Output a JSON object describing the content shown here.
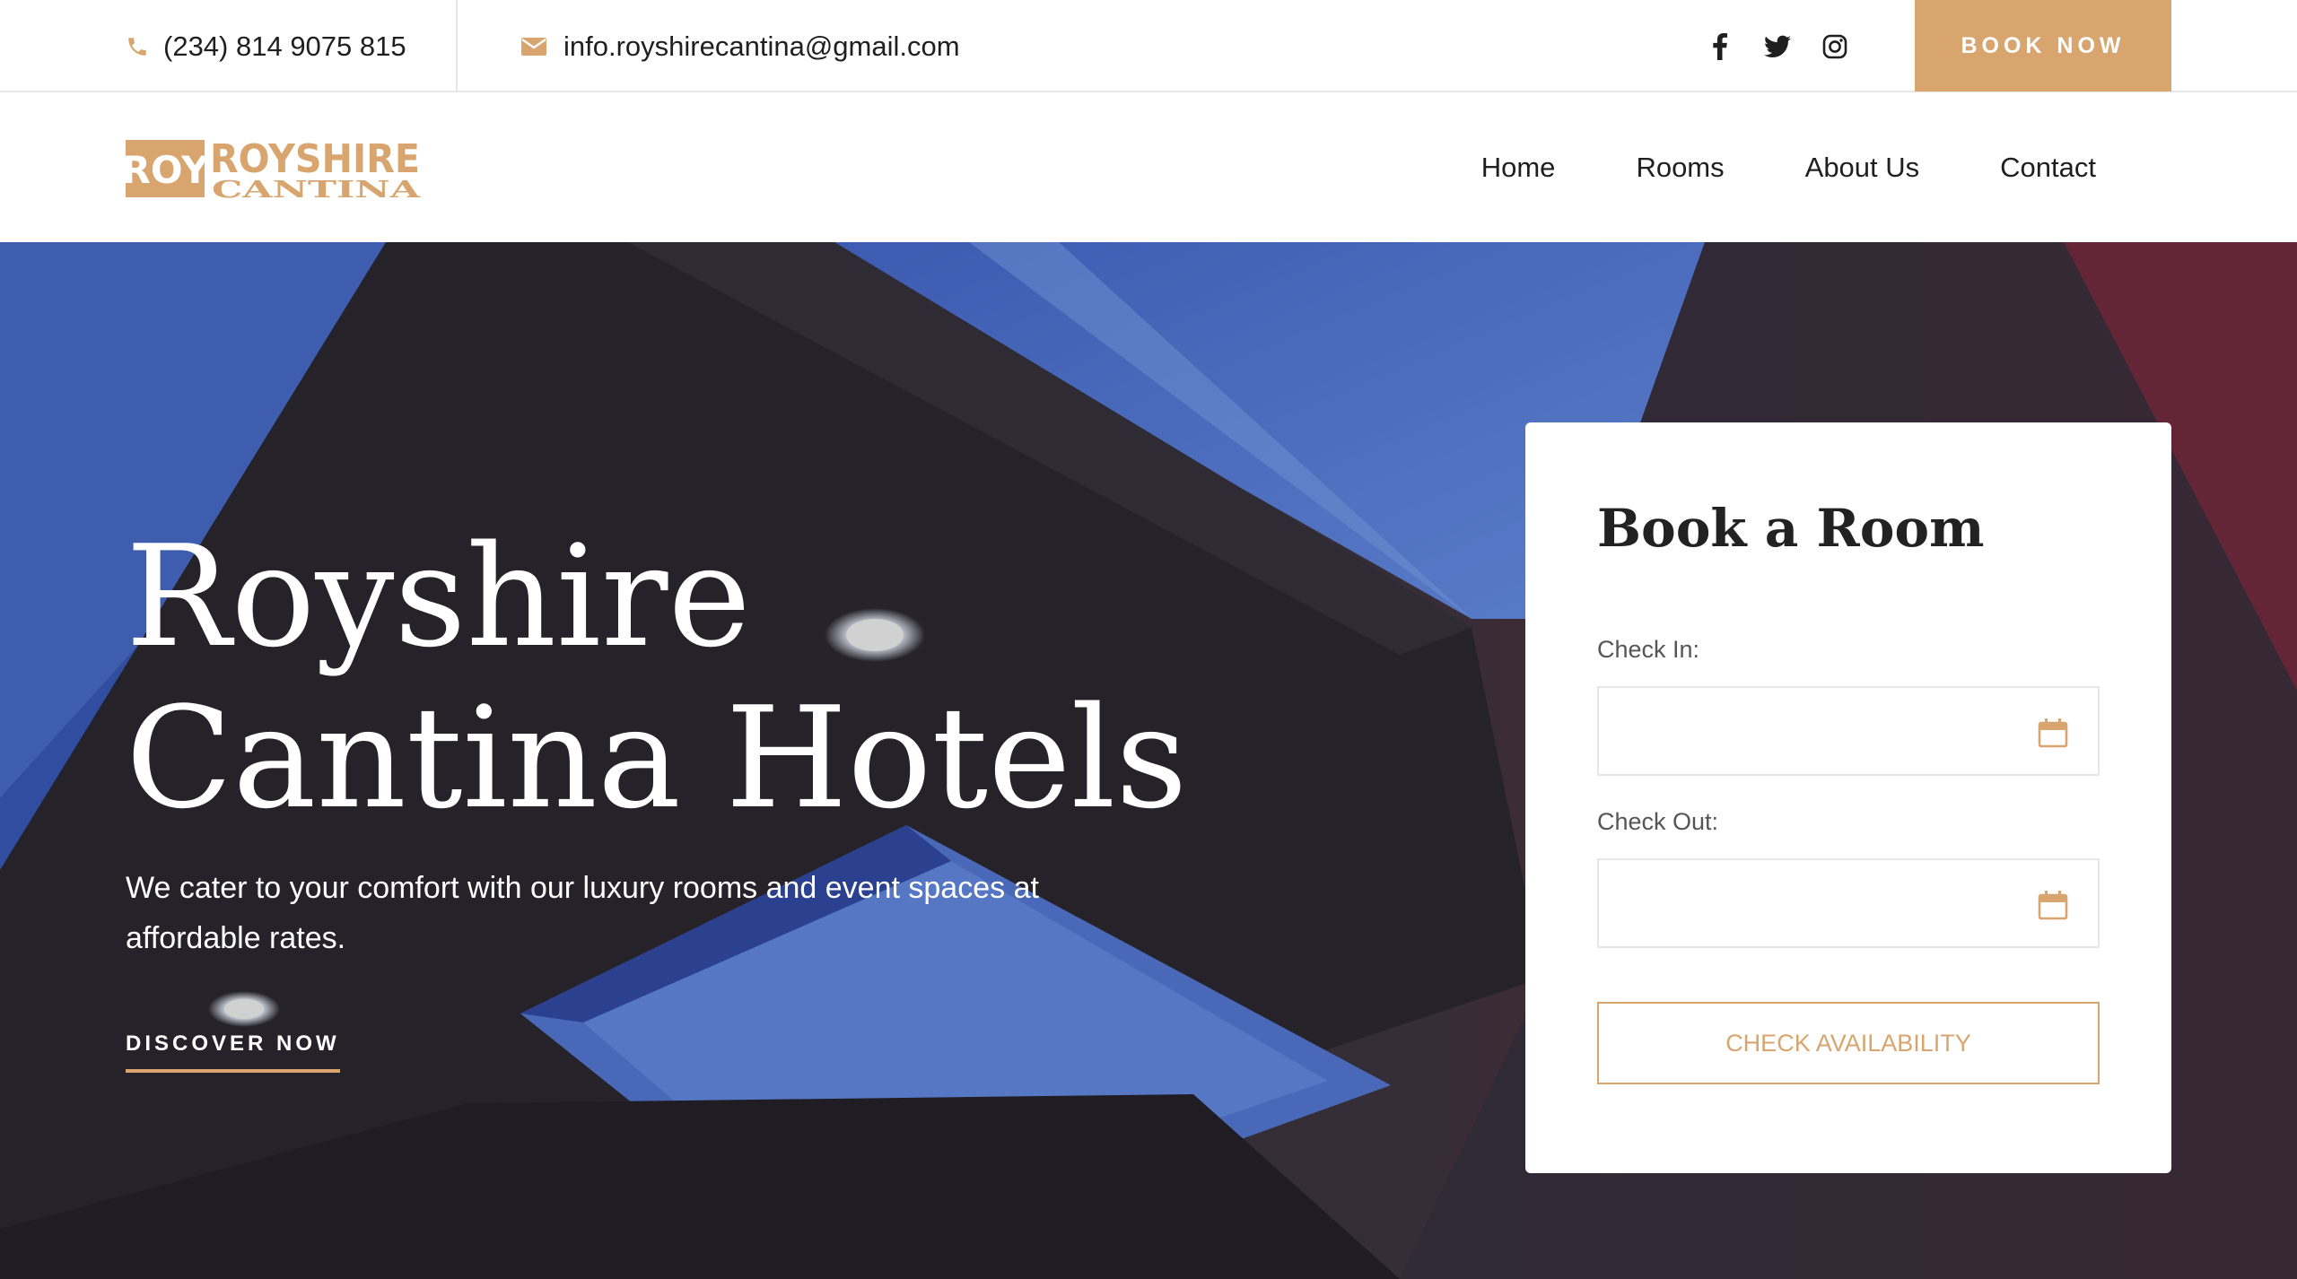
{
  "topbar": {
    "phone": "(234) 814 9075 815",
    "email": "info.royshirecantina@gmail.com",
    "socials": [
      {
        "name": "facebook",
        "icon": "facebook-icon"
      },
      {
        "name": "twitter",
        "icon": "twitter-icon"
      },
      {
        "name": "instagram",
        "icon": "instagram-icon"
      }
    ],
    "book_now": "BOOK NOW"
  },
  "logo": {
    "mark": "ROY",
    "line1": "ROYSHIRE",
    "line2": "CANTINA"
  },
  "nav": {
    "items": [
      "Home",
      "Rooms",
      "About Us",
      "Contact"
    ]
  },
  "hero": {
    "title_line1": "Royshire",
    "title_line2": "Cantina Hotels",
    "subtitle": "We cater to your comfort with our luxury rooms and event spaces at affordable rates.",
    "cta": "DISCOVER NOW"
  },
  "booking": {
    "title": "Book a Room",
    "check_in_label": "Check In:",
    "check_in_value": "",
    "check_out_label": "Check Out:",
    "check_out_value": "",
    "button": "CHECK AVAILABILITY"
  },
  "colors": {
    "accent": "#d8a56e",
    "text": "#1f1f1f",
    "border": "#e6e6e6"
  }
}
